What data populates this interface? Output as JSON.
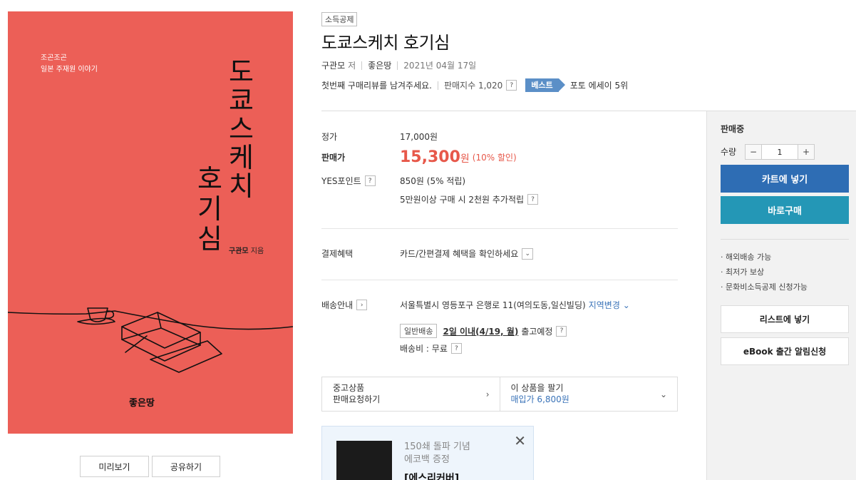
{
  "cover": {
    "subtitle_line1": "조곤조곤",
    "subtitle_line2": "일본 주재원 이야기",
    "title_chars": [
      "도",
      "쿄",
      "스",
      "케",
      "치",
      "호",
      "기",
      "심"
    ],
    "author": "구관모",
    "author_suffix": "지음",
    "publisher_logo": "좋은땅"
  },
  "cover_buttons": {
    "preview": "미리보기",
    "share": "공유하기"
  },
  "product": {
    "badge": "소득공제",
    "title": "도쿄스케치 호기심",
    "author": "구관모",
    "author_role": "저",
    "publisher": "좋은땅",
    "date": "2021년 04월 17일",
    "review_prompt": "첫번째 구매리뷰를 남겨주세요.",
    "sales_index": "판매지수 1,020",
    "best_tag": "베스트",
    "best_rank": "포토 에세이 5위"
  },
  "price": {
    "list_label": "정가",
    "list_value": "17,000원",
    "sale_label": "판매가",
    "sale_amount": "15,300",
    "sale_unit": "원",
    "discount": "(10% 할인)",
    "points_label": "YES포인트",
    "points_value": "850원 (5% 적립)",
    "points_extra": "5만원이상 구매 시 2천원 추가적립"
  },
  "payment": {
    "label": "결제혜택",
    "value": "카드/간편결제 혜택을 확인하세요"
  },
  "shipping": {
    "label": "배송안내",
    "address": "서울특별시 영등포구 은행로 11(여의도동,일신빌딩)",
    "change_link": "지역변경",
    "type_tag": "일반배송",
    "eta": "2일 이내(4/19, 월)",
    "eta_suffix": "출고예정",
    "fee": "배송비 : 무료"
  },
  "used": {
    "left_line1": "중고상품",
    "left_line2": "판매요청하기",
    "right_line1": "이 상품을 팔기",
    "right_line2": "매입가 6,800원"
  },
  "promo": {
    "line1": "150쇄 돌파 기념",
    "line2": "에코백 증정",
    "bold": "[에스리커버]"
  },
  "side": {
    "status": "판매중",
    "qty_label": "수량",
    "qty_value": "1",
    "cart_button": "카트에 넣기",
    "buy_button": "바로구매",
    "benefits": [
      "해외배송 가능",
      "최저가 보상",
      "문화비소득공제 신청가능"
    ],
    "list_button": "리스트에 넣기",
    "ebook_button": "eBook 출간 알림신청"
  },
  "colors": {
    "cover_bg": "#ec5f57",
    "price_red": "#e7584a",
    "cart_blue": "#2e6db4",
    "buy_teal": "#2497b6",
    "best_blue": "#5b8fc7"
  }
}
